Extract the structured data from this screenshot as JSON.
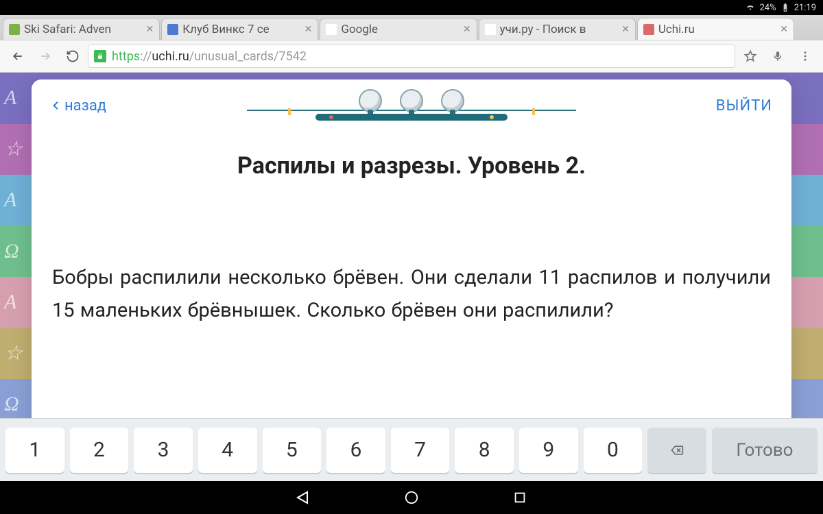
{
  "status": {
    "battery": "24%",
    "clock": "21:19"
  },
  "tabs": [
    {
      "label": "Ski Safari: Adven",
      "fav": "#7cb342"
    },
    {
      "label": "Клуб Винкс 7 се",
      "fav": "#4a7bd1"
    },
    {
      "label": "Google",
      "fav": "#ffffff"
    },
    {
      "label": "учи.ру - Поиск в",
      "fav": "#ffffff"
    },
    {
      "label": "Uchi.ru",
      "fav": "#d96b6b",
      "active": true
    }
  ],
  "url": {
    "scheme": "https",
    "sep": "://",
    "host": "uchi.ru",
    "path": "/unusual_cards/7542"
  },
  "card": {
    "back": "назад",
    "exit": "ВЫЙТИ",
    "title": "Распилы и разрезы. Уровень 2.",
    "body": "Бобры распилили несколько брёвен. Они сделали 11 распилов и получили 15 маленьких брёвнышек. Сколько брёвен они распилили?"
  },
  "osk": {
    "keys": [
      "1",
      "2",
      "3",
      "4",
      "5",
      "6",
      "7",
      "8",
      "9",
      "0"
    ],
    "done": "Готово"
  }
}
